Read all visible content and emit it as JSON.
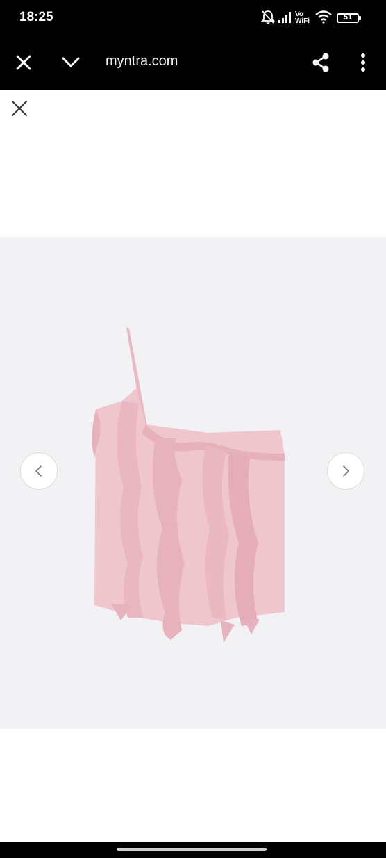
{
  "status_bar": {
    "time": "18:25",
    "network_label_top": "Vo",
    "network_label_bottom": "WiFi",
    "battery_level": "51",
    "icons": [
      "bell-off-icon",
      "signal-icon",
      "wifi-icon",
      "battery-icon"
    ]
  },
  "browser": {
    "url": "myntra.com",
    "icons": [
      "close-icon",
      "chevron-down-icon",
      "share-icon",
      "more-vert-icon"
    ]
  },
  "viewer": {
    "product_image_alt": "",
    "close_icon": "close-icon",
    "prev_icon": "chevron-left-icon",
    "next_icon": "chevron-right-icon",
    "colors": {
      "background": "#f2f1f3",
      "garment": "#efc6cd",
      "garment_shadow": "#e2aab6"
    }
  }
}
